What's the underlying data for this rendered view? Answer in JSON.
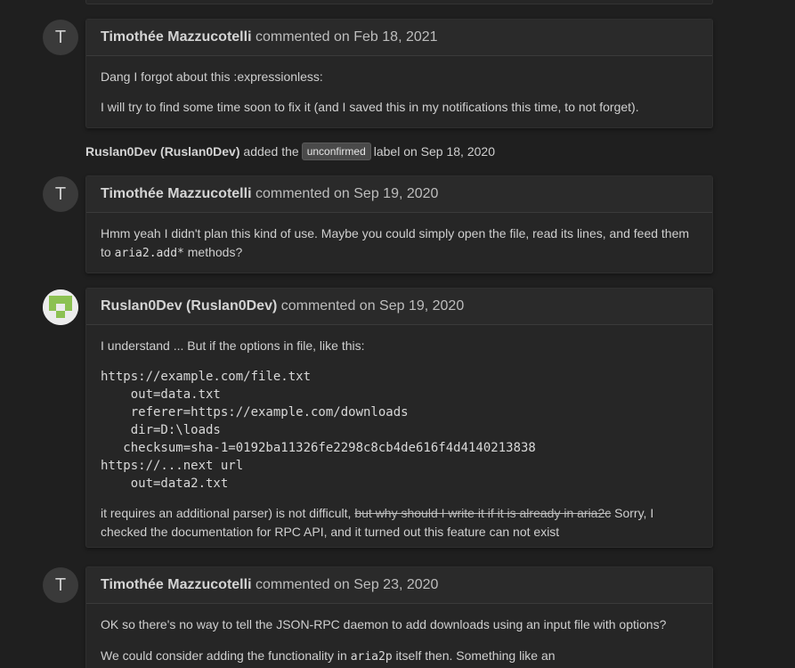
{
  "comments": [
    {
      "avatar_letter": "T",
      "author": "Timothée Mazzucotelli",
      "action": "commented on Feb 18, 2021",
      "body": [
        "Dang I forgot about this :expressionless:",
        "I will try to find some time soon to fix it (and I saved this in my notifications this time, to not forget)."
      ]
    },
    {
      "avatar_letter": "T",
      "author": "Timothée Mazzucotelli",
      "action": "commented on Sep 19, 2020",
      "body_before": "Hmm yeah I didn't plan this kind of use. Maybe you could simply open the file, read its lines, and feed them to ",
      "body_code": "aria2.add*",
      "body_after": " methods?"
    },
    {
      "avatar_icon": "identicon-avatar",
      "author": "Ruslan0Dev (Ruslan0Dev)",
      "action": "commented on Sep 19, 2020",
      "intro": "I understand ... But if the options in file, like this:",
      "code_lines": [
        "https://example.com/file.txt",
        "    out=data.txt",
        "    referer=https://example.com/downloads",
        "    dir=D:\\loads",
        "   checksum=sha-1=0192ba11326fe2298c8cb4de616f4d4140213838",
        "https://...next url",
        "    out=data2.txt"
      ],
      "outro_before": "it requires an additional parser) is not difficult, ",
      "outro_strike": "but why should I write it if it is already in aria2c",
      "outro_after": " Sorry, I checked the documentation for RPC API, and it turned out this feature can not exist"
    },
    {
      "avatar_letter": "T",
      "author": "Timothée Mazzucotelli",
      "action": "commented on Sep 23, 2020",
      "line1": "OK so there's no way to tell the JSON-RPC daemon to add downloads using an input file with options?",
      "line2_before": "We could consider adding the functionality in ",
      "line2_code": "aria2p",
      "line2_after": " itself then. Something like an"
    }
  ],
  "event": {
    "actor": "Ruslan0Dev (Ruslan0Dev)",
    "text_before": "added the",
    "label": "unconfirmed",
    "text_after": "label on Sep 18, 2020"
  },
  "colors": {
    "background": "#1f1f1f",
    "box": "#262626",
    "label": "#4a4a4a",
    "identicon": "#8cc152"
  }
}
